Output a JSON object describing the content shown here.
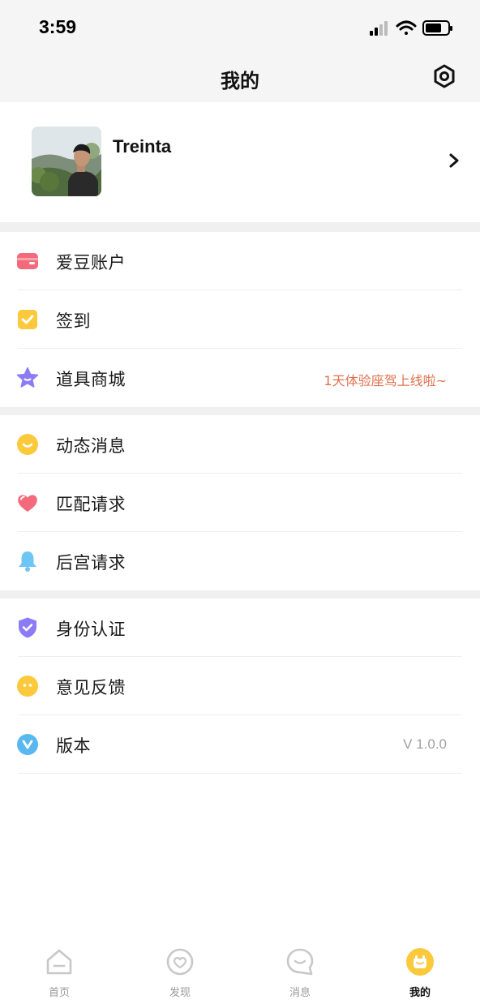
{
  "status_bar": {
    "time": "3:59"
  },
  "header": {
    "title": "我的",
    "settings_icon": "settings-icon"
  },
  "profile": {
    "name": "Treinta"
  },
  "menu_groups": [
    [
      {
        "label": "爱豆账户",
        "icon": "wallet-icon",
        "color": "#f36b7b"
      },
      {
        "label": "签到",
        "icon": "checkbox-icon",
        "color": "#fbc93b"
      },
      {
        "label": "道具商城",
        "icon": "star-face-icon",
        "color": "#8b7cf6",
        "value": "1天体验座驾上线啦~"
      }
    ],
    [
      {
        "label": "动态消息",
        "icon": "smile-icon",
        "color": "#fbc93b"
      },
      {
        "label": "匹配请求",
        "icon": "heart-icon",
        "color": "#f36b7b"
      },
      {
        "label": "后宫请求",
        "icon": "bell-icon",
        "color": "#6ec6f5"
      }
    ],
    [
      {
        "label": "身份认证",
        "icon": "shield-check-icon",
        "color": "#8b7cf6"
      },
      {
        "label": "意见反馈",
        "icon": "feedback-face-icon",
        "color": "#fbc93b"
      },
      {
        "label": "版本",
        "icon": "version-v-icon",
        "color": "#5ab8f0",
        "value": "V 1.0.0"
      }
    ]
  ],
  "tabs": [
    {
      "label": "首页",
      "icon": "home-icon"
    },
    {
      "label": "发现",
      "icon": "discover-icon"
    },
    {
      "label": "消息",
      "icon": "message-icon"
    },
    {
      "label": "我的",
      "icon": "me-icon",
      "active": true
    }
  ],
  "colors": {
    "accent": "#fbc93b",
    "promo_text": "#e0714e",
    "background_gap": "#f0f0f0"
  }
}
